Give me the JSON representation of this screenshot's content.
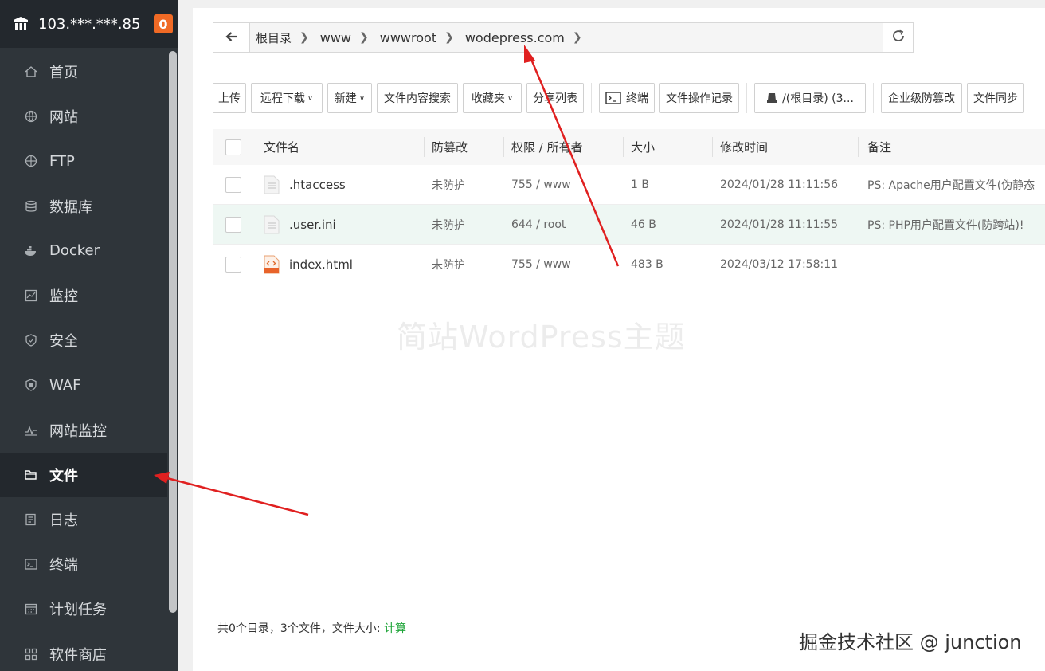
{
  "sidebar": {
    "server_ip": "103.***.***.85",
    "badge": "0",
    "items": [
      {
        "label": "首页",
        "icon": "home-icon"
      },
      {
        "label": "网站",
        "icon": "globe-icon"
      },
      {
        "label": "FTP",
        "icon": "ftp-globe-icon"
      },
      {
        "label": "数据库",
        "icon": "database-icon"
      },
      {
        "label": "Docker",
        "icon": "docker-icon"
      },
      {
        "label": "监控",
        "icon": "monitor-icon"
      },
      {
        "label": "安全",
        "icon": "shield-icon"
      },
      {
        "label": "WAF",
        "icon": "waf-shield-icon"
      },
      {
        "label": "网站监控",
        "icon": "pulse-icon"
      },
      {
        "label": "文件",
        "icon": "folder-icon",
        "active": true
      },
      {
        "label": "日志",
        "icon": "log-icon"
      },
      {
        "label": "终端",
        "icon": "terminal-icon"
      },
      {
        "label": "计划任务",
        "icon": "calendar-icon"
      },
      {
        "label": "软件商店",
        "icon": "apps-icon"
      }
    ]
  },
  "path": {
    "crumbs": [
      "根目录",
      "www",
      "wwwroot",
      "wodepress.com"
    ]
  },
  "toolbar": {
    "upload": "上传",
    "remote_download": "远程下载",
    "new": "新建",
    "content_search": "文件内容搜索",
    "favorites": "收藏夹",
    "share_list": "分享列表",
    "terminal": "终端",
    "op_log": "文件操作记录",
    "disk": "/(根目录) (3...",
    "tamper": "企业级防篡改",
    "sync": "文件同步"
  },
  "table": {
    "headers": {
      "name": "文件名",
      "protect": "防篡改",
      "perm": "权限 / 所有者",
      "size": "大小",
      "mtime": "修改时间",
      "note": "备注"
    },
    "rows": [
      {
        "name": ".htaccess",
        "protect": "未防护",
        "perm": "755 / www",
        "size": "1 B",
        "mtime": "2024/01/28 11:11:56",
        "note": "PS: Apache用户配置文件(伪静态"
      },
      {
        "name": ".user.ini",
        "protect": "未防护",
        "perm": "644 / root",
        "size": "46 B",
        "mtime": "2024/01/28 11:11:55",
        "note": "PS: PHP用户配置文件(防跨站)!"
      },
      {
        "name": "index.html",
        "protect": "未防护",
        "perm": "755 / www",
        "size": "483 B",
        "mtime": "2024/03/12 17:58:11",
        "note": ""
      }
    ]
  },
  "footer": {
    "summary": "共0个目录，3个文件，文件大小: ",
    "calc": "计算"
  },
  "watermark": "简站WordPress主题",
  "credit": "掘金技术社区 @ junction",
  "colors": {
    "accent_green": "#20a53a",
    "badge_orange": "#f06a25",
    "sidebar_bg": "#2f353a",
    "arrow_red": "#e02020"
  }
}
